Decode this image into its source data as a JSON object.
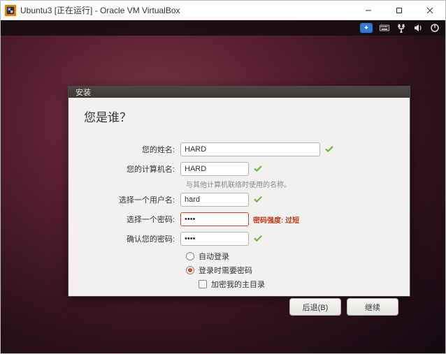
{
  "window": {
    "title": "Ubuntu3 [正在运行] - Oracle VM VirtualBox"
  },
  "menubar": {
    "indicators": {
      "accessibility": "accessibility-icon",
      "keyboard": "keyboard-icon",
      "network": "network-icon",
      "volume": "volume-icon",
      "power": "power-icon"
    }
  },
  "installer": {
    "titlebar": "安装",
    "heading": "您是谁？",
    "fields": {
      "fullname": {
        "label": "您的姓名:",
        "value": "HARD"
      },
      "hostname": {
        "label": "您的计算机名:",
        "value": "HARD",
        "hint": "与其他计算机联络时使用的名称。"
      },
      "username": {
        "label": "选择一个用户名:",
        "value": "hard"
      },
      "password": {
        "label": "选择一个密码:",
        "value": "••••",
        "strength_label": "密码强度: 过短"
      },
      "confirm": {
        "label": "确认您的密码:",
        "value": "••••"
      }
    },
    "options": {
      "auto_login": {
        "label": "自动登录",
        "selected": false
      },
      "require_pw": {
        "label": "登录时需要密码",
        "selected": true
      },
      "encrypt_home": {
        "label": "加密我的主目录",
        "checked": false
      }
    },
    "buttons": {
      "back": "后退(B)",
      "continue": "继续"
    }
  }
}
